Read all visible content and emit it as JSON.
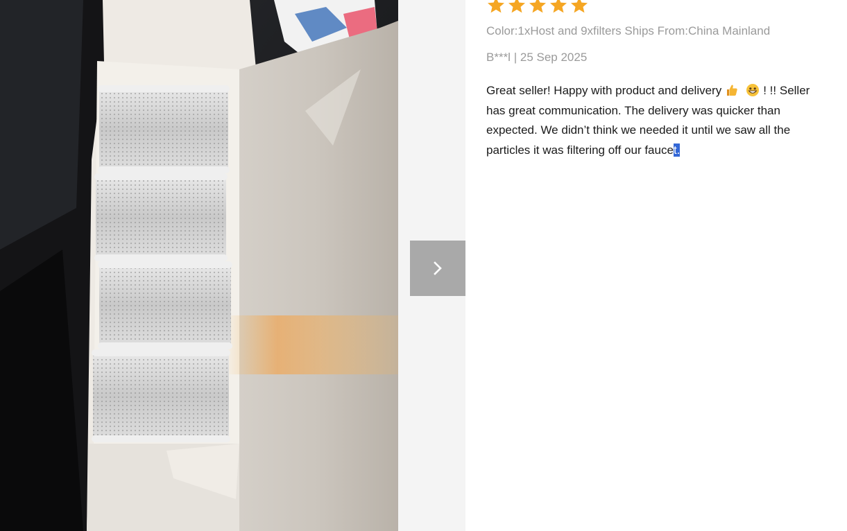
{
  "review": {
    "rating": 5,
    "rating_max": 5,
    "color_label": "Color:",
    "color_value": "1xHost and 9xfilters",
    "ships_label": "Ships From:",
    "ships_value": "China Mainland",
    "author": "B***l",
    "separator": "|",
    "date": "25 Sep 2025",
    "text_part1": "Great seller! Happy with product and delivery",
    "emoji1": "thumbs-up",
    "emoji2": "grinning-face",
    "text_part2": "! !! Seller has great communication. The delivery was quicker than expected. We didn’t think we needed it until we saw all the particles it was filtering off our fauce",
    "text_selected": "t."
  },
  "gallery": {
    "next_icon": "chevron-right-icon",
    "photo_subject": "box-of-water-filter-cartridges"
  },
  "colors": {
    "star": "#f5a623",
    "meta_text": "#9a9a9a",
    "selection": "#3367d6",
    "nav_button": "#a9a9a9"
  }
}
